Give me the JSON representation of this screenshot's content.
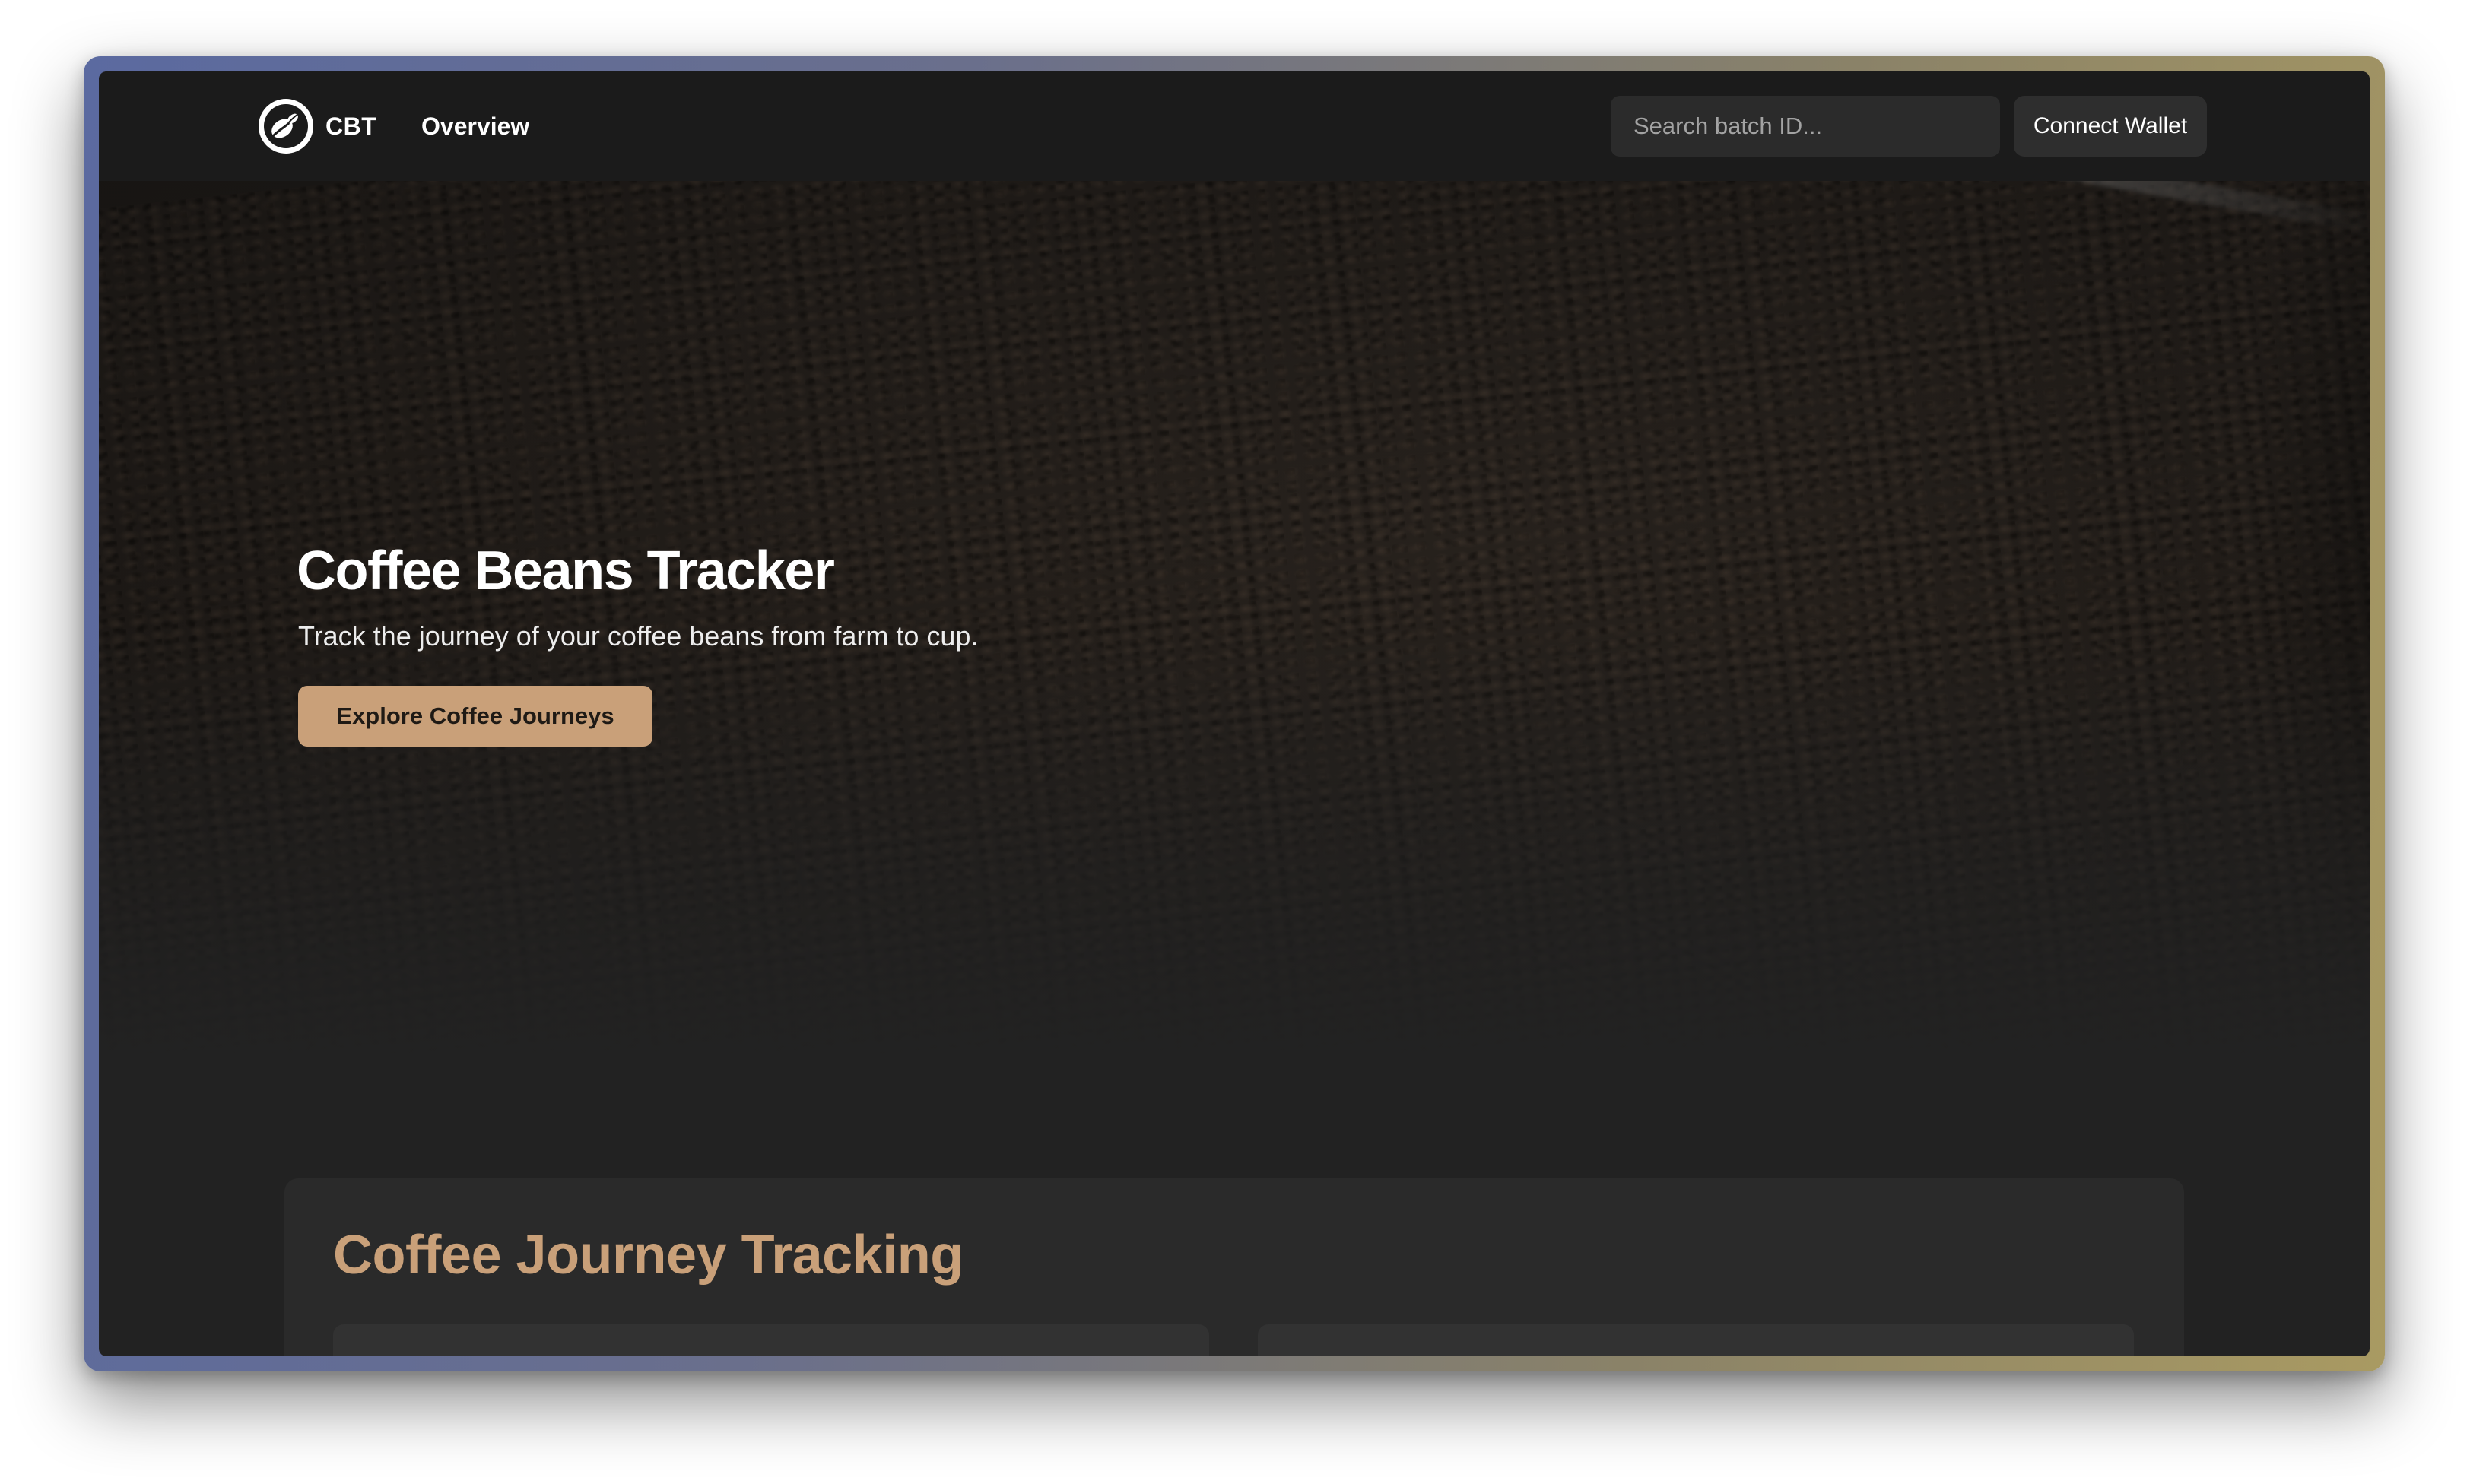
{
  "navbar": {
    "brand": "CBT",
    "logo_icon": "coffee-bean-icon",
    "links": [
      {
        "label": "Overview"
      }
    ],
    "search": {
      "placeholder": "Search batch ID...",
      "value": ""
    },
    "connect_wallet_label": "Connect Wallet"
  },
  "hero": {
    "title": "Coffee Beans Tracker",
    "subtitle": "Track the journey of your coffee beans from farm to cup.",
    "cta_label": "Explore Coffee Journeys"
  },
  "tracking": {
    "title": "Coffee Journey Tracking"
  },
  "colors": {
    "accent": "#c9a079",
    "navbar_bg": "#1b1b1b",
    "page_bg": "#222222",
    "card_bg": "#2a2a2a"
  }
}
